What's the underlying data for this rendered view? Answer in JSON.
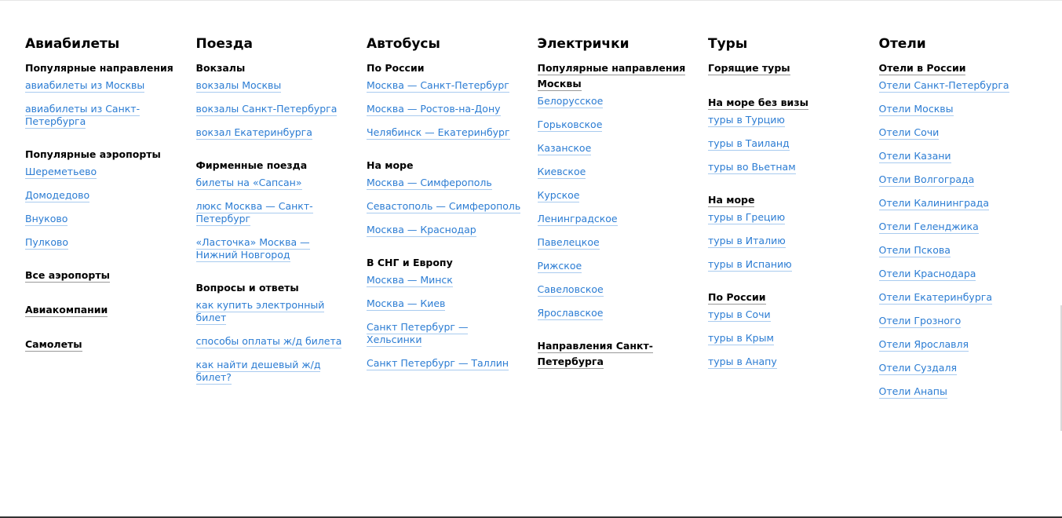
{
  "columns": [
    {
      "title": "Авиабилеты",
      "groups": [
        {
          "title": "Популярные направления",
          "linked": false,
          "links": [
            "авиабилеты из Москвы",
            "авиабилеты из Санкт-Петербурга"
          ]
        },
        {
          "title": "Популярные аэропорты",
          "linked": false,
          "links": [
            "Шереметьево",
            "Домодедово",
            "Внуково",
            "Пулково"
          ]
        },
        {
          "title": "Все аэропорты",
          "linked": true,
          "links": []
        },
        {
          "title": "Авиакомпании",
          "linked": true,
          "links": []
        },
        {
          "title": "Самолеты",
          "linked": true,
          "links": []
        }
      ]
    },
    {
      "title": "Поезда",
      "groups": [
        {
          "title": "Вокзалы",
          "linked": false,
          "links": [
            "вокзалы Москвы",
            "вокзалы Санкт-Петербурга",
            "вокзал Екатеринбурга"
          ]
        },
        {
          "title": "Фирменные поезда",
          "linked": false,
          "links": [
            "билеты на «Сапсан»",
            "люкс Москва — Санкт-Петербург",
            "«Ласточка» Москва — Нижний Новгород"
          ]
        },
        {
          "title": "Вопросы и ответы",
          "linked": false,
          "links": [
            "как купить электронный билет",
            "способы оплаты ж/д билета",
            "как найти дешевый ж/д билет?"
          ]
        }
      ]
    },
    {
      "title": "Автобусы",
      "groups": [
        {
          "title": "По России",
          "linked": false,
          "links": [
            "Москва — Санкт-Петербург",
            "Москва — Ростов-на-Дону",
            "Челябинск — Екатеринбург"
          ]
        },
        {
          "title": "На море",
          "linked": false,
          "links": [
            "Москва — Симферополь",
            "Севастополь — Симферополь",
            "Москва — Краснодар"
          ]
        },
        {
          "title": "В СНГ и Европу",
          "linked": false,
          "links": [
            "Москва — Минск",
            "Москва — Киев",
            "Санкт Петербург — Хельсинки",
            "Санкт Петербург — Таллин"
          ]
        }
      ]
    },
    {
      "title": "Электрички",
      "groups": [
        {
          "title": "Популярные направления Москвы",
          "linked": true,
          "links": [
            "Белорусское",
            "Горьковское",
            "Казанское",
            "Киевское",
            "Курское",
            "Ленинградское",
            "Павелецкое",
            "Рижское",
            "Савеловское",
            "Ярославское"
          ]
        },
        {
          "title": "Направления Санкт-Петербурга",
          "linked": true,
          "links": []
        }
      ]
    },
    {
      "title": "Туры",
      "groups": [
        {
          "title": "Горящие туры",
          "linked": true,
          "links": []
        },
        {
          "title": "На море без визы",
          "linked": true,
          "links": [
            "туры в Турцию",
            "туры в Таиланд",
            "туры во Вьетнам"
          ]
        },
        {
          "title": "На море",
          "linked": true,
          "links": [
            "туры в Грецию",
            "туры в Италию",
            "туры в Испанию"
          ]
        },
        {
          "title": "По России",
          "linked": true,
          "links": [
            "туры в Сочи",
            "туры в Крым",
            "туры в Анапу"
          ]
        }
      ]
    },
    {
      "title": "Отели",
      "groups": [
        {
          "title": "Отели в России",
          "linked": true,
          "links": [
            "Отели Санкт-Петербурга",
            "Отели Москвы",
            "Отели Сочи",
            "Отели Казани",
            "Отели Волгограда",
            "Отели Калининграда",
            "Отели Геленджика",
            "Отели Пскова",
            "Отели Краснодара",
            "Отели Екатеринбурга",
            "Отели Грозного",
            "Отели Ярославля",
            "Отели Суздаля",
            "Отели Анапы"
          ]
        }
      ]
    }
  ],
  "colors": {
    "link": "#2b7cd3",
    "heading": "#000000"
  }
}
